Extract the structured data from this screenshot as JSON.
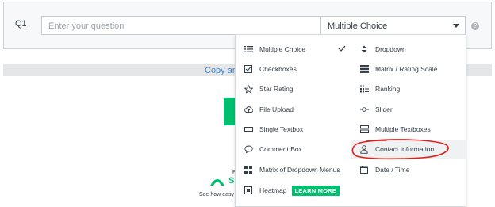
{
  "question": {
    "number": "Q1",
    "placeholder": "Enter your question",
    "type_selected": "Multiple Choice",
    "help_symbol": "?"
  },
  "background": {
    "copy_text": "Copy and",
    "footer_p": "P",
    "brand_text": "S",
    "see_how": "See how easy"
  },
  "menu": {
    "left": [
      {
        "label": "Multiple Choice",
        "icon": "list-icon",
        "checked": true
      },
      {
        "label": "Checkboxes",
        "icon": "checkbox-icon"
      },
      {
        "label": "Star Rating",
        "icon": "star-icon"
      },
      {
        "label": "File Upload",
        "icon": "upload-icon"
      },
      {
        "label": "Single Textbox",
        "icon": "textbox-icon"
      },
      {
        "label": "Comment Box",
        "icon": "comment-icon"
      },
      {
        "label": "Matrix of Dropdown Menus",
        "icon": "matrix-dropdown-icon"
      },
      {
        "label": "Heatmap",
        "icon": "heatmap-icon",
        "badge": "LEARN MORE"
      }
    ],
    "right": [
      {
        "label": "Dropdown",
        "icon": "dropdown-icon"
      },
      {
        "label": "Matrix / Rating Scale",
        "icon": "grid-icon"
      },
      {
        "label": "Ranking",
        "icon": "ranking-icon"
      },
      {
        "label": "Slider",
        "icon": "slider-icon"
      },
      {
        "label": "Multiple Textboxes",
        "icon": "multi-textbox-icon"
      },
      {
        "label": "Contact Information",
        "icon": "person-icon",
        "highlighted": true
      },
      {
        "label": "Date / Time",
        "icon": "calendar-icon"
      }
    ]
  },
  "colors": {
    "accent_green": "#00bf6f",
    "annotation_red": "#e0201b",
    "link_blue": "#3e87c9"
  }
}
